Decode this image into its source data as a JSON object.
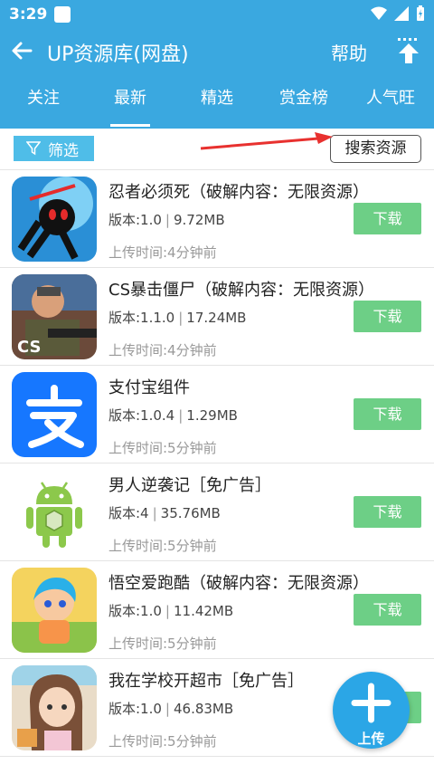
{
  "status_bar": {
    "time": "3:29"
  },
  "app_bar": {
    "title": "UP资源库(网盘)",
    "help_label": "帮助"
  },
  "tabs": [
    {
      "label": "关注",
      "active": false
    },
    {
      "label": "最新",
      "active": true
    },
    {
      "label": "精选",
      "active": false
    },
    {
      "label": "赏金榜",
      "active": false
    },
    {
      "label": "人气旺",
      "active": false
    }
  ],
  "filter_bar": {
    "filter_label": "筛选",
    "search_label": "搜索资源"
  },
  "items": [
    {
      "name": "忍者必须死（破解内容：无限资源）",
      "version": "版本:1.0",
      "size": "9.72MB",
      "time": "上传时间:4分钟前",
      "download_label": "下载",
      "icon": "ninja-game-icon"
    },
    {
      "name": "CS暴击僵尸（破解内容：无限资源）",
      "version": "版本:1.1.0",
      "size": "17.24MB",
      "time": "上传时间:4分钟前",
      "download_label": "下载",
      "icon": "cs-game-icon"
    },
    {
      "name": "支付宝组件",
      "version": "版本:1.0.4",
      "size": "1.29MB",
      "time": "上传时间:5分钟前",
      "download_label": "下载",
      "icon": "alipay-icon"
    },
    {
      "name": "男人逆袭记［免广告］",
      "version": "版本:4",
      "size": "35.76MB",
      "time": "上传时间:5分钟前",
      "download_label": "下载",
      "icon": "android-icon"
    },
    {
      "name": "悟空爱跑酷（破解内容：无限资源）",
      "version": "版本:1.0",
      "size": "11.42MB",
      "time": "上传时间:5分钟前",
      "download_label": "下载",
      "icon": "wukong-game-icon"
    },
    {
      "name": "我在学校开超市［免广告］",
      "version": "版本:1.0",
      "size": "46.83MB",
      "time": "上传时间:5分钟前",
      "download_label": "下载",
      "icon": "school-shop-game-icon"
    }
  ],
  "fab": {
    "label": "上传"
  },
  "colors": {
    "primary": "#3aa8e0",
    "download": "#6dcf86",
    "arrow": "#e8312f"
  }
}
